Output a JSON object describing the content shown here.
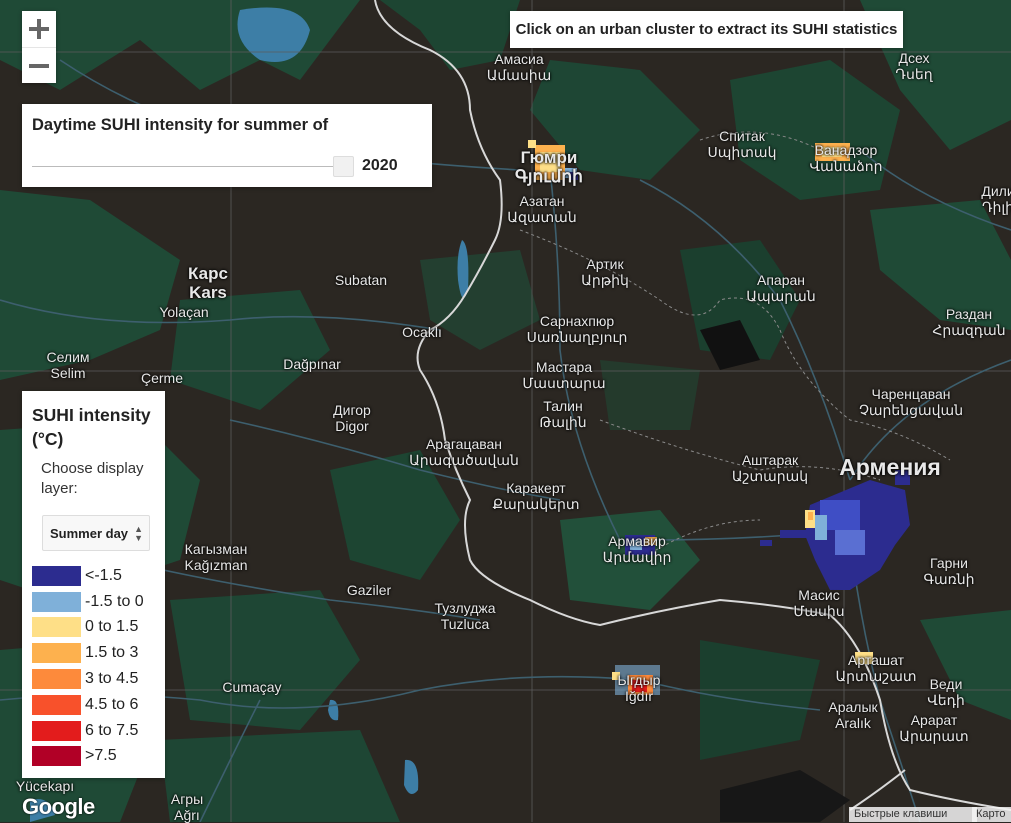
{
  "hint": "Click on an urban cluster to extract its SUHI statistics",
  "zoom": {
    "in": "+",
    "out": "−"
  },
  "slider": {
    "title": "Daytime SUHI intensity for summer of",
    "year": "2020"
  },
  "legend": {
    "title": "SUHI intensity (°C)",
    "subtitle": "Choose display layer:",
    "layer": "Summer day",
    "items": [
      {
        "label": "<-1.5",
        "color": "#2c2c8f"
      },
      {
        "label": "-1.5 to 0",
        "color": "#7fb0d9"
      },
      {
        "label": "0 to 1.5",
        "color": "#fedf87"
      },
      {
        "label": "1.5 to 3",
        "color": "#fdb14e"
      },
      {
        "label": "3 to 4.5",
        "color": "#fd8a3b"
      },
      {
        "label": "4.5 to 6",
        "color": "#f8512b"
      },
      {
        "label": "6 to 7.5",
        "color": "#e31c1c"
      },
      {
        "label": ">7.5",
        "color": "#b10026"
      }
    ]
  },
  "labels": {
    "amasia": "Амасиа",
    "amasia_hy": "Ամասիա",
    "gyumri": "Гюмри",
    "gyumri_hy": "Գյումրի",
    "azatan": "Азатан",
    "azatan_hy": "Ազատան",
    "spitak": "Спитак",
    "spitak_hy": "Սպիտակ",
    "vanadzor": "Ванадзор",
    "vanadzor_hy": "Վանաձոր",
    "dsekh": "Дсех",
    "dsekh_hy": "Դսեղ",
    "dili": "Дили",
    "dili_hy": "Դիլի",
    "kars": "Карс",
    "kars_tr": "Kars",
    "subatan": "Subatan",
    "yolacan": "Yolaçan",
    "artik": "Артик",
    "artik_hy": "Արթիկ",
    "aparan": "Апаран",
    "aparan_hy": "Ապարան",
    "sarnakhpyur": "Сарнахпюр",
    "sarnakhpyur_hy": "Սառնաղբյուր",
    "razdan": "Раздан",
    "razdan_hy": "Հրազդան",
    "ocakli": "Ocaklı",
    "selim": "Селим",
    "selim_tr": "Selim",
    "dagpinar": "Dağpınar",
    "mastara": "Мастара",
    "mastara_hy": "Մաստարա",
    "cerme": "Çerme",
    "digor": "Дигор",
    "digor_tr": "Digor",
    "talin": "Талин",
    "talin_hy": "Թալին",
    "charentsavan": "Чаренцаван",
    "charentsavan_hy": "Չարենցավան",
    "aragatsavan": "Арагацаван",
    "aragatsavan_hy": "Արագածավան",
    "ashtarak": "Аштарак",
    "ashtarak_hy": "Աշտարակ",
    "armenia": "Армения",
    "karakert": "Каракерт",
    "karakert_hy": "Քարակերտ",
    "kagizman": "Кагызман",
    "kagizman_tr": "Kağızman",
    "armavir": "Армавир",
    "armavir_hy": "Արմավիր",
    "garni": "Гарни",
    "garni_hy": "Գառնի",
    "gaziler": "Gaziler",
    "masis": "Масис",
    "masis_hy": "Մասիս",
    "tuzluca": "Тузлуджа",
    "tuzluca_tr": "Tuzluca",
    "artashat": "Арташат",
    "artashat_hy": "Արտաշատ",
    "igdir": "Ыгдыр",
    "igdir_tr": "Iğdır",
    "vedi": "Веди",
    "vedi_hy": "Վեդի",
    "cumacay": "Cumaçay",
    "araliq": "Аралык",
    "araliq_tr": "Aralık",
    "ararat": "Арарат",
    "ararat_hy": "Արարատ",
    "yucekapi": "Yücekapı",
    "agri": "Агры",
    "agri_tr": "Ağrı"
  },
  "google": "Google",
  "attribution": {
    "shortcuts": "Быстрые клавиши",
    "map": "Карто"
  }
}
